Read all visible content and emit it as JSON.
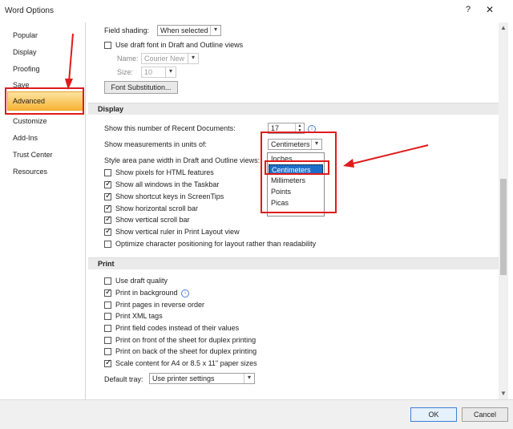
{
  "window": {
    "title": "Word Options",
    "help": "?",
    "close": "✕"
  },
  "sidebar": {
    "items": [
      {
        "label": "Popular"
      },
      {
        "label": "Display"
      },
      {
        "label": "Proofing"
      },
      {
        "label": "Save"
      },
      {
        "label": "Advanced"
      },
      {
        "label": "Customize"
      },
      {
        "label": "Add-Ins"
      },
      {
        "label": "Trust Center"
      },
      {
        "label": "Resources"
      }
    ]
  },
  "top": {
    "field_shading_label": "Field shading:",
    "field_shading_value": "When selected",
    "draft_font_label": "Use draft font in Draft and Outline views",
    "name_label": "Name:",
    "name_value": "Courier New",
    "size_label": "Size:",
    "size_value": "10",
    "font_sub_button": "Font Substitution..."
  },
  "display": {
    "section": "Display",
    "recent_docs_label": "Show this number of Recent Documents:",
    "recent_docs_value": "17",
    "units_label": "Show measurements in units of:",
    "units_value": "Centimeters",
    "style_area_label": "Style area pane width in Draft and Outline views:",
    "unit_options": [
      "Inches",
      "Centimeters",
      "Millimeters",
      "Points",
      "Picas"
    ],
    "checks": [
      {
        "label": "Show pixels for HTML features",
        "checked": false
      },
      {
        "label": "Show all windows in the Taskbar",
        "checked": true
      },
      {
        "label": "Show shortcut keys in ScreenTips",
        "checked": true
      },
      {
        "label": "Show horizontal scroll bar",
        "checked": true
      },
      {
        "label": "Show vertical scroll bar",
        "checked": true
      },
      {
        "label": "Show vertical ruler in Print Layout view",
        "checked": true
      },
      {
        "label": "Optimize character positioning for layout rather than readability",
        "checked": false
      }
    ]
  },
  "print": {
    "section": "Print",
    "checks": [
      {
        "label": "Use draft quality",
        "checked": false
      },
      {
        "label": "Print in background",
        "checked": true
      },
      {
        "label": "Print pages in reverse order",
        "checked": false
      },
      {
        "label": "Print XML tags",
        "checked": false
      },
      {
        "label": "Print field codes instead of their values",
        "checked": false
      },
      {
        "label": "Print on front of the sheet for duplex printing",
        "checked": false
      },
      {
        "label": "Print on back of the sheet for duplex printing",
        "checked": false
      },
      {
        "label": "Scale content for A4 or 8.5 x 11\" paper sizes",
        "checked": true
      }
    ],
    "default_tray_label": "Default tray:",
    "default_tray_value": "Use printer settings"
  },
  "footer": {
    "ok": "OK",
    "cancel": "Cancel"
  },
  "colors": {
    "annotation": "#e01b1b",
    "selection": "#1e6fc9",
    "active_tab": "#f8b437"
  }
}
